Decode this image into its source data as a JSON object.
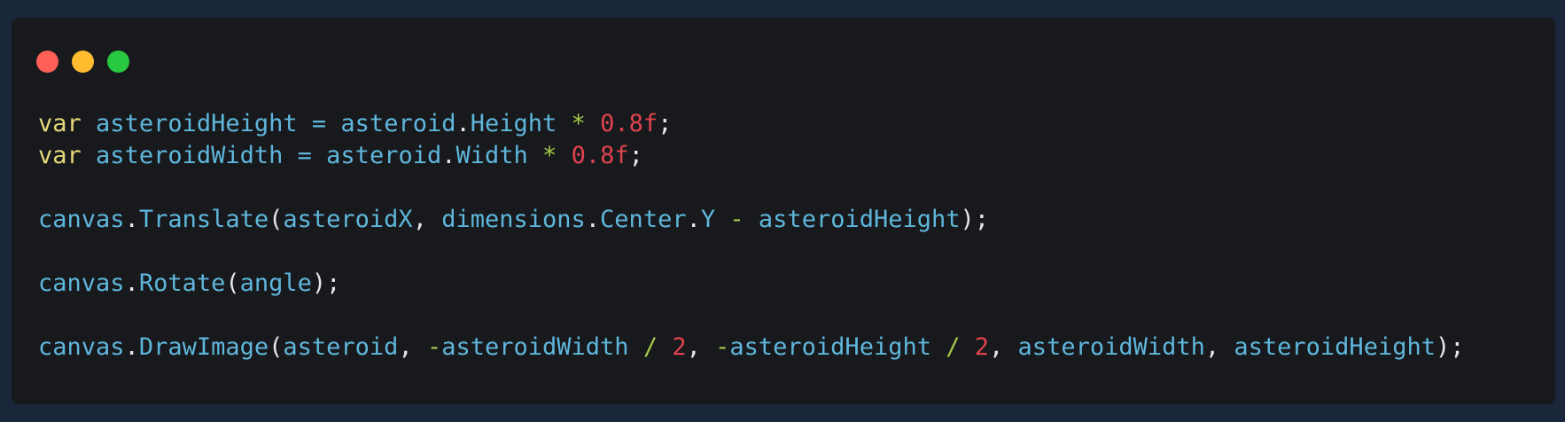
{
  "colors": {
    "page_background": "#1a263a",
    "window_background": "#17191c",
    "keyword": "#e6d97d",
    "identifier": "#5fb6dc",
    "number": "#e0434f",
    "operator": "#a4c94b",
    "punct": "#e6e6e6"
  },
  "window": {
    "controls": [
      {
        "name": "close",
        "color": "#ff5f57",
        "icon": "red-circle"
      },
      {
        "name": "minimize",
        "color": "#febc2e",
        "icon": "yellow-circle"
      },
      {
        "name": "maximize",
        "color": "#28c840",
        "icon": "green-circle"
      }
    ]
  },
  "code": {
    "lines": [
      [
        {
          "t": "var",
          "k": "keyword"
        },
        {
          "t": " ",
          "k": "punct"
        },
        {
          "t": "asteroidHeight",
          "k": "identifier"
        },
        {
          "t": " ",
          "k": "punct"
        },
        {
          "t": "=",
          "k": "identifier"
        },
        {
          "t": " ",
          "k": "punct"
        },
        {
          "t": "asteroid",
          "k": "identifier"
        },
        {
          "t": ".",
          "k": "punct"
        },
        {
          "t": "Height",
          "k": "identifier"
        },
        {
          "t": " ",
          "k": "punct"
        },
        {
          "t": "*",
          "k": "operator"
        },
        {
          "t": " ",
          "k": "punct"
        },
        {
          "t": "0.8f",
          "k": "number"
        },
        {
          "t": ";",
          "k": "punct"
        }
      ],
      [
        {
          "t": "var",
          "k": "keyword"
        },
        {
          "t": " ",
          "k": "punct"
        },
        {
          "t": "asteroidWidth",
          "k": "identifier"
        },
        {
          "t": " ",
          "k": "punct"
        },
        {
          "t": "=",
          "k": "identifier"
        },
        {
          "t": " ",
          "k": "punct"
        },
        {
          "t": "asteroid",
          "k": "identifier"
        },
        {
          "t": ".",
          "k": "punct"
        },
        {
          "t": "Width",
          "k": "identifier"
        },
        {
          "t": " ",
          "k": "punct"
        },
        {
          "t": "*",
          "k": "operator"
        },
        {
          "t": " ",
          "k": "punct"
        },
        {
          "t": "0.8f",
          "k": "number"
        },
        {
          "t": ";",
          "k": "punct"
        }
      ],
      [],
      [
        {
          "t": "canvas",
          "k": "identifier"
        },
        {
          "t": ".",
          "k": "punct"
        },
        {
          "t": "Translate",
          "k": "identifier"
        },
        {
          "t": "(",
          "k": "punct"
        },
        {
          "t": "asteroidX",
          "k": "identifier"
        },
        {
          "t": ", ",
          "k": "punct"
        },
        {
          "t": "dimensions",
          "k": "identifier"
        },
        {
          "t": ".",
          "k": "punct"
        },
        {
          "t": "Center",
          "k": "identifier"
        },
        {
          "t": ".",
          "k": "punct"
        },
        {
          "t": "Y",
          "k": "identifier"
        },
        {
          "t": " ",
          "k": "punct"
        },
        {
          "t": "-",
          "k": "operator"
        },
        {
          "t": " ",
          "k": "punct"
        },
        {
          "t": "asteroidHeight",
          "k": "identifier"
        },
        {
          "t": ");",
          "k": "punct"
        }
      ],
      [],
      [
        {
          "t": "canvas",
          "k": "identifier"
        },
        {
          "t": ".",
          "k": "punct"
        },
        {
          "t": "Rotate",
          "k": "identifier"
        },
        {
          "t": "(",
          "k": "punct"
        },
        {
          "t": "angle",
          "k": "identifier"
        },
        {
          "t": ");",
          "k": "punct"
        }
      ],
      [],
      [
        {
          "t": "canvas",
          "k": "identifier"
        },
        {
          "t": ".",
          "k": "punct"
        },
        {
          "t": "DrawImage",
          "k": "identifier"
        },
        {
          "t": "(",
          "k": "punct"
        },
        {
          "t": "asteroid",
          "k": "identifier"
        },
        {
          "t": ", ",
          "k": "punct"
        },
        {
          "t": "-",
          "k": "operator"
        },
        {
          "t": "asteroidWidth",
          "k": "identifier"
        },
        {
          "t": " ",
          "k": "punct"
        },
        {
          "t": "/",
          "k": "operator"
        },
        {
          "t": " ",
          "k": "punct"
        },
        {
          "t": "2",
          "k": "number"
        },
        {
          "t": ", ",
          "k": "punct"
        },
        {
          "t": "-",
          "k": "operator"
        },
        {
          "t": "asteroidHeight",
          "k": "identifier"
        },
        {
          "t": " ",
          "k": "punct"
        },
        {
          "t": "/",
          "k": "operator"
        },
        {
          "t": " ",
          "k": "punct"
        },
        {
          "t": "2",
          "k": "number"
        },
        {
          "t": ", ",
          "k": "punct"
        },
        {
          "t": "asteroidWidth",
          "k": "identifier"
        },
        {
          "t": ", ",
          "k": "punct"
        },
        {
          "t": "asteroidHeight",
          "k": "identifier"
        },
        {
          "t": ");",
          "k": "punct"
        }
      ]
    ]
  }
}
